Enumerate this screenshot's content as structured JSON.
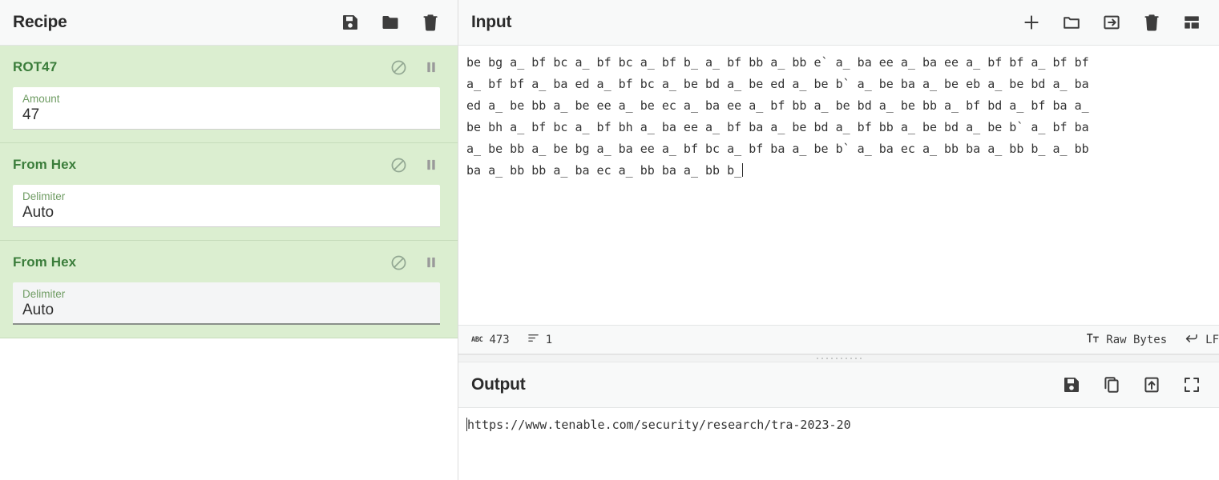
{
  "recipe": {
    "title": "Recipe",
    "header_icons": [
      {
        "name": "save-recipe-icon",
        "label": "Save recipe"
      },
      {
        "name": "load-recipe-icon",
        "label": "Load recipe"
      },
      {
        "name": "clear-recipe-icon",
        "label": "Clear recipe"
      }
    ],
    "operations": [
      {
        "name": "ROT47",
        "disable_label": "Disable operation",
        "pause_label": "Set breakpoint",
        "arg_label": "Amount",
        "arg_value": "47",
        "focused": false
      },
      {
        "name": "From Hex",
        "disable_label": "Disable operation",
        "pause_label": "Set breakpoint",
        "arg_label": "Delimiter",
        "arg_value": "Auto",
        "focused": false
      },
      {
        "name": "From Hex",
        "disable_label": "Disable operation",
        "pause_label": "Set breakpoint",
        "arg_label": "Delimiter",
        "arg_value": "Auto",
        "focused": true
      }
    ]
  },
  "input": {
    "title": "Input",
    "header_icons": [
      {
        "name": "add-input-tab-icon",
        "label": "Add a new input tab"
      },
      {
        "name": "open-folder-icon",
        "label": "Open folder as input"
      },
      {
        "name": "open-file-icon",
        "label": "Open file as input"
      },
      {
        "name": "clear-input-icon",
        "label": "Clear input and output"
      },
      {
        "name": "reset-pane-layout-icon",
        "label": "Reset pane layout"
      }
    ],
    "text_lines": [
      "be bg a_ bf bc a_ bf bc a_ bf b_ a_ bf bb a_ bb e` a_ ba ee a_ ba ee a_ bf bf a_ bf bf",
      "a_ bf bf a_ ba ed a_ bf bc a_ be bd a_ be ed a_ be b` a_ be ba a_ be eb a_ be bd a_ ba",
      "ed a_ be bb a_ be ee a_ be ec a_ ba ee a_ bf bb a_ be bd a_ be bb a_ bf bd a_ bf ba a_",
      "be bh a_ bf bc a_ bf bh a_ ba ee a_ bf ba a_ be bd a_ bf bb a_ be bd a_ be b` a_ bf ba",
      "a_ be bb a_ be bg a_ ba ee a_ bf bc a_ bf ba a_ be b` a_ ba ec a_ bb ba a_ bb b_ a_ bb",
      "ba a_ bb bb a_ ba ec a_ bb ba a_ bb b_"
    ],
    "status": {
      "length_icon": "ABC",
      "length_value": "473",
      "lines_icon": "lines-icon",
      "lines_value": "1",
      "encoding_icon": "character-encoding-icon",
      "encoding_label": "Raw Bytes",
      "eol_icon": "line-ending-icon",
      "eol_label": "LF"
    }
  },
  "output": {
    "title": "Output",
    "header_icons": [
      {
        "name": "save-output-icon",
        "label": "Save output to file"
      },
      {
        "name": "copy-output-icon",
        "label": "Copy raw output to the clipboard"
      },
      {
        "name": "replace-input-icon",
        "label": "Replace input with output"
      },
      {
        "name": "maximise-output-icon",
        "label": "Maximise output pane"
      }
    ],
    "text": "https://www.tenable.com/security/research/tra-2023-20"
  },
  "colors": {
    "operation_background": "#dbeed0",
    "operation_title": "#3b7d3b",
    "arg_label": "#6f9c63",
    "header_background": "#f8f9f9",
    "text": "#333333"
  }
}
